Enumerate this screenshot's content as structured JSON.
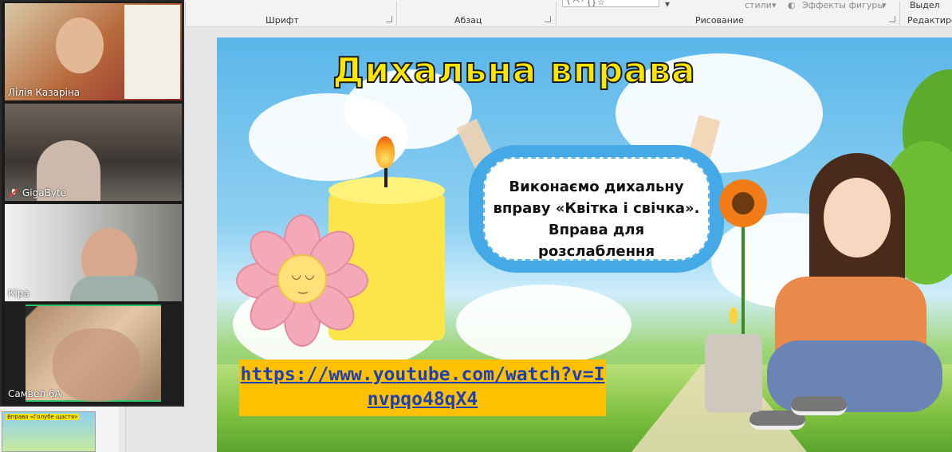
{
  "ribbon": {
    "groups": [
      {
        "label": "Шрифт"
      },
      {
        "label": "Абзац"
      },
      {
        "label": "Рисование"
      },
      {
        "label": "Редактиро"
      }
    ],
    "styles_label": "стили",
    "shape_effects_label": "Эффекты фигуры",
    "select_label": "Выдел"
  },
  "participants": [
    {
      "name": "Лілія Казаріна",
      "muted": false
    },
    {
      "name": "GigaByte",
      "muted": true
    },
    {
      "name": "Кіра",
      "muted": false
    },
    {
      "name": "Самвел 6А",
      "muted": false,
      "active_speaker": true
    }
  ],
  "slide": {
    "title": "Дихальна вправа",
    "bubble_lines": [
      "Виконаємо дихальну",
      "вправу «Квітка і свічка».",
      "Вправа для",
      "розслаблення"
    ],
    "link": "https://www.youtube.com/watch?v=Invpqo48qX4"
  },
  "thumbnail": {
    "title": "Вправа «Голубе щастя»"
  },
  "colors": {
    "title_fill": "#ffe600",
    "link_box": "#ffc000",
    "link_text": "#1f3fb4",
    "bubble": "#44a9e6",
    "active_speaker": "#2ec26f"
  }
}
